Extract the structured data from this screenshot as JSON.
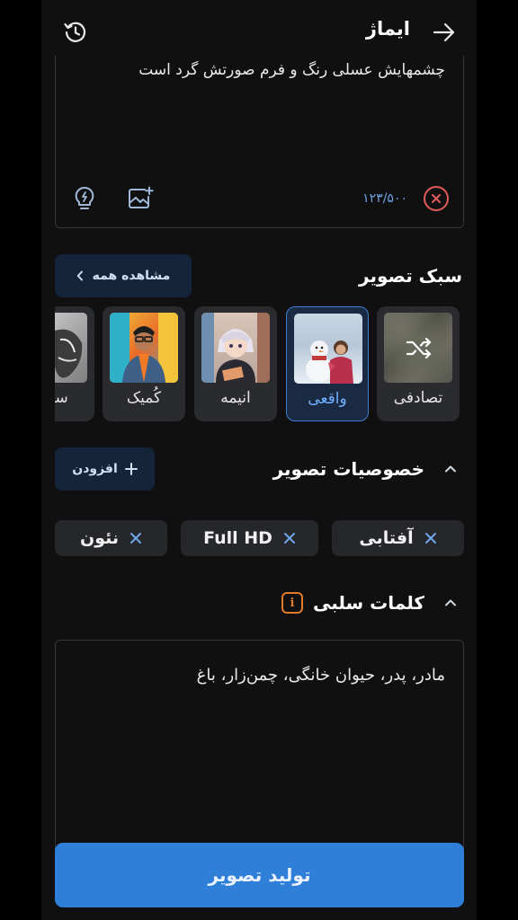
{
  "header": {
    "title": "ایماژ",
    "back_icon": "arrow-right-icon",
    "history_icon": "history-icon"
  },
  "prompt": {
    "text": "چشمهایش عسلی رنگ و فرم صورتش گرد است",
    "char_count": "۱۲۳/۵۰۰",
    "ideas_icon": "lightbulb-icon",
    "add_image_icon": "image-plus-icon",
    "clear_icon": "close-circle-icon"
  },
  "style_section": {
    "title": "سبک تصویر",
    "see_all_label": "مشاهده همه",
    "styles": [
      {
        "label": "تصادفی",
        "selected": false
      },
      {
        "label": "واقعی",
        "selected": true
      },
      {
        "label": "انیمه",
        "selected": false
      },
      {
        "label": "کُمیک",
        "selected": false
      },
      {
        "label": "سیاه",
        "selected": false
      }
    ]
  },
  "features_section": {
    "title": "خصوصیات تصویر",
    "add_label": "افزودن",
    "chips": [
      "آفتابی",
      "Full HD",
      "نئون"
    ]
  },
  "negative_section": {
    "title": "کلمات سلبی",
    "text": "مادر، پدر، حیوان خانگی، چمن‌زار، باغ"
  },
  "generate_label": "تولید تصویر",
  "colors": {
    "accent": "#2f7ed8",
    "selected_border": "#3e7fd4",
    "clear_red": "#e05b5b",
    "info_orange": "#e07a2b"
  }
}
